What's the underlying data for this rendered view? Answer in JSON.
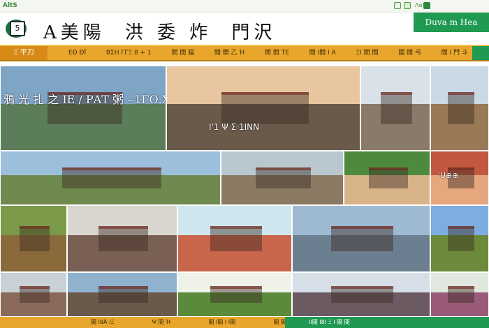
{
  "topbar": {
    "brand": "AltS",
    "label": "Λα"
  },
  "header": {
    "logo_text": "G",
    "logo_mark": "5",
    "title_part1": "Α美陽",
    "title_part2": "洪 委 炸",
    "title_part3": "門沢",
    "action_label": "Duva m Hea"
  },
  "nav": {
    "home_label": "Ξ 平刀",
    "items": [
      "ΕĐ ĐĪ",
      "ΒΣΗ ΓΓΞ 8 + 1",
      "問 間 猫",
      "間 関 乙 Ή",
      "問 間 ΤΕ",
      "間 Ι間 Ι Α",
      "ΞΙ 間 間",
      "國 間 弓",
      "間 Ι 門 斗"
    ]
  },
  "tiles": [
    {
      "caption": "鴉 光 扎 之 IE / ΡΑΤ 粥 ‒1ΓΟ.Χ",
      "colors": {
        "sky": "#7fa5c6",
        "ground": "#5b7d5a"
      }
    },
    {
      "caption": "Ι'1 Ψ Σ 1ΙΝΝ",
      "colors": {
        "sky": "#e7c6a0",
        "ground": "#6a5a4a"
      }
    },
    {
      "caption": "",
      "colors": {
        "sky": "#d8e2e8",
        "ground": "#8a7a6a"
      }
    },
    {
      "caption": "",
      "colors": {
        "sky": "#c9d9e6",
        "ground": "#9a7a56"
      }
    },
    {
      "caption": "",
      "colors": {
        "sky": "#9cc0dc",
        "ground": "#6f8a4f"
      }
    },
    {
      "caption": "",
      "colors": {
        "sky": "#b9c7cf",
        "ground": "#8b7a63"
      }
    },
    {
      "caption": "",
      "colors": {
        "sky": "#4d8a3e",
        "ground": "#d9b48a"
      }
    },
    {
      "caption": "'U⊕⊕",
      "colors": {
        "sky": "#c25840",
        "ground": "#e6a77e"
      }
    },
    {
      "caption": "",
      "colors": {
        "sky": "#7a9a48",
        "ground": "#8a6a3a"
      }
    },
    {
      "caption": "",
      "colors": {
        "sky": "#d9d6cf",
        "ground": "#7a5f55"
      }
    },
    {
      "caption": "",
      "colors": {
        "sky": "#d0e6ee",
        "ground": "#c9654a"
      }
    },
    {
      "caption": "",
      "colors": {
        "sky": "#9eb9d2",
        "ground": "#6c7f90"
      }
    },
    {
      "caption": "",
      "colors": {
        "sky": "#7eaee0",
        "ground": "#6b8a3a"
      }
    },
    {
      "caption": "",
      "colors": {
        "sky": "#c9d1d6",
        "ground": "#8a6a5a"
      }
    },
    {
      "caption": "",
      "colors": {
        "sky": "#8fb3cf",
        "ground": "#6a5a4a"
      }
    },
    {
      "caption": "",
      "colors": {
        "sky": "#eef2e8",
        "ground": "#5a8a3a"
      }
    },
    {
      "caption": "",
      "colors": {
        "sky": "#d6dfe7",
        "ground": "#6c5a63"
      }
    },
    {
      "caption": "",
      "colors": {
        "sky": "#e0e8df",
        "ground": "#9a5a7a"
      }
    }
  ],
  "footer": {
    "links": [
      "間 Ι8Ά ΙΞ",
      "Ψ 問 Ή",
      "間 Ι間 Ι Ι間",
      "間 間"
    ],
    "green_text": "ΙΙ間 Ι8Ι Ξ Ι 間 間"
  }
}
